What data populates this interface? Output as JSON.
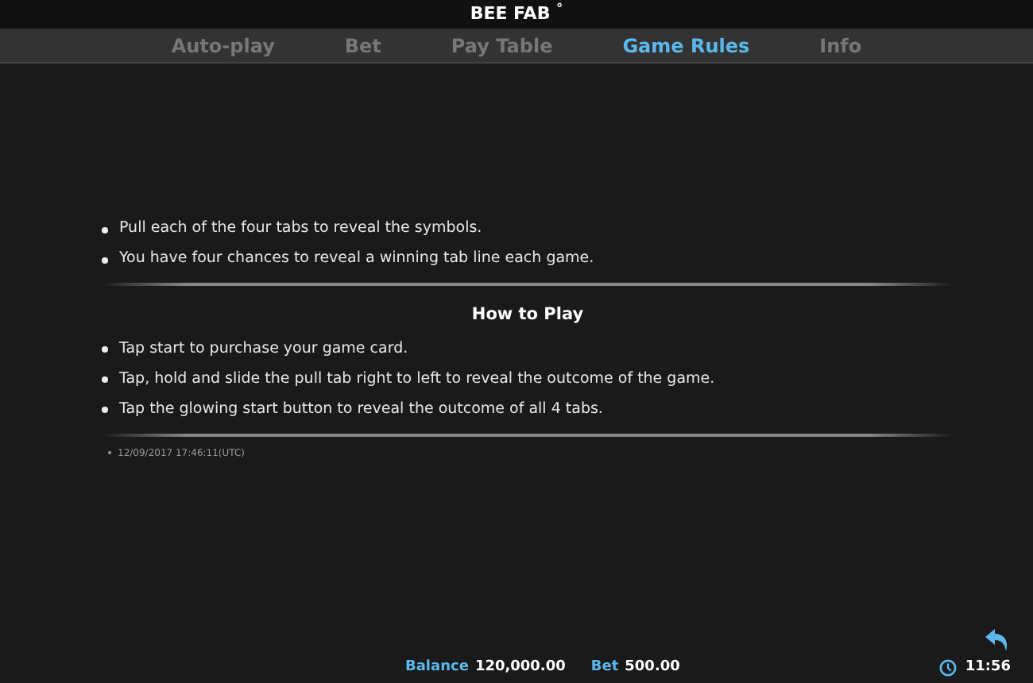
{
  "title": "BEE FAB $^{°}$",
  "tabs": [
    {
      "label": "Auto-play",
      "selected": false
    },
    {
      "label": "Bet",
      "selected": false
    },
    {
      "label": "Pay Table",
      "selected": false
    },
    {
      "label": "Game Rules",
      "selected": true
    },
    {
      "label": "Info",
      "selected": false
    }
  ],
  "rules": [
    "Pull each of the four tabs to reveal the symbols.",
    "You have four chances to reveal a winning tab line each game."
  ],
  "how_to_play": {
    "heading": "How to Play",
    "items": [
      "Tap start to purchase your game card.",
      "Tap, hold and slide the pull tab right to left to reveal the outcome of the game.",
      "Tap the glowing start button to reveal the outcome of all 4 tabs."
    ]
  },
  "timestamp": "12/09/2017 17:46:11(UTC)",
  "footer": {
    "balance_label": "Balance",
    "balance": "120,000.00",
    "bet_label": "Bet",
    "bet": "500.00",
    "time": "11:56"
  }
}
